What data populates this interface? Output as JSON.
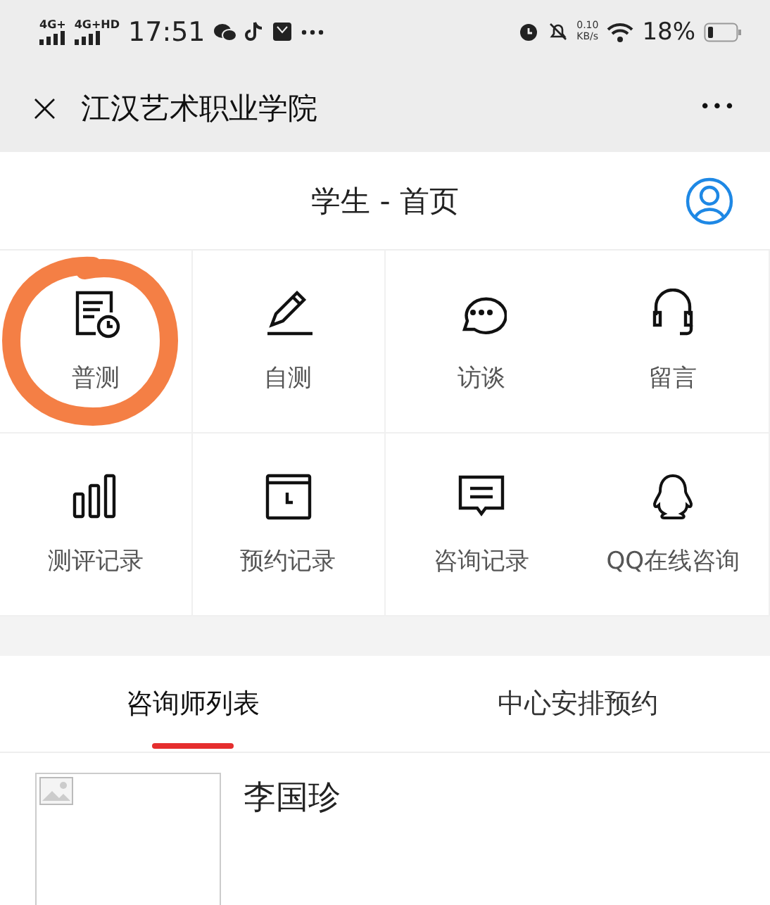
{
  "status_bar": {
    "signal_1": "4G+",
    "signal_2": "4G+HD",
    "time": "17:51",
    "net_speed": "0.10",
    "net_unit": "KB/s",
    "battery": "18%"
  },
  "nav_bar": {
    "close": "×",
    "title": "江汉艺术职业学院",
    "more": "•••"
  },
  "header": {
    "title": "学生 - 首页"
  },
  "tiles": [
    {
      "label": "普测",
      "circled": true
    },
    {
      "label": "自测",
      "circled": false
    },
    {
      "label": "访谈",
      "circled": false
    },
    {
      "label": "留言",
      "circled": false
    },
    {
      "label": "测评记录",
      "circled": false
    },
    {
      "label": "预约记录",
      "circled": false
    },
    {
      "label": "咨询记录",
      "circled": false
    },
    {
      "label": "QQ在线咨询",
      "circled": false
    }
  ],
  "tabs": [
    {
      "label": "咨询师列表",
      "selected": true
    },
    {
      "label": "中心安排预约",
      "selected": false
    }
  ],
  "counselors": [
    {
      "name": "李国珍"
    }
  ]
}
